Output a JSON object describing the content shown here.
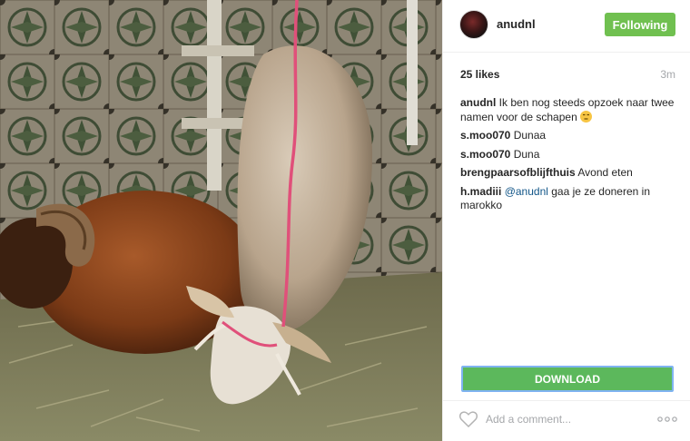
{
  "post": {
    "username": "anudnl",
    "follow_label": "Following",
    "likes": "25 likes",
    "time": "3m"
  },
  "comments": [
    {
      "user": "anudnl",
      "text": "Ik ben nog steeds opzoek naar twee namen voor de schapen",
      "emoji": "unamused-face"
    },
    {
      "user": "s.moo070",
      "text": "Dunaa"
    },
    {
      "user": "s.moo070",
      "text": "Duna"
    },
    {
      "user": "brengpaarsofblijfthuis",
      "text": "Avond eten"
    },
    {
      "user": "h.madiii",
      "mention": "@anudnl",
      "text": "gaa je ze doneren in marokko"
    }
  ],
  "actions": {
    "download_label": "DOWNLOAD",
    "comment_placeholder": "Add a comment...",
    "like_icon": "heart-icon",
    "more_icon": "more-options-icon"
  },
  "colors": {
    "follow_button": "#70c050",
    "download_button": "#5cb85c",
    "mention": "#125688",
    "muted": "#a5a7aa"
  }
}
